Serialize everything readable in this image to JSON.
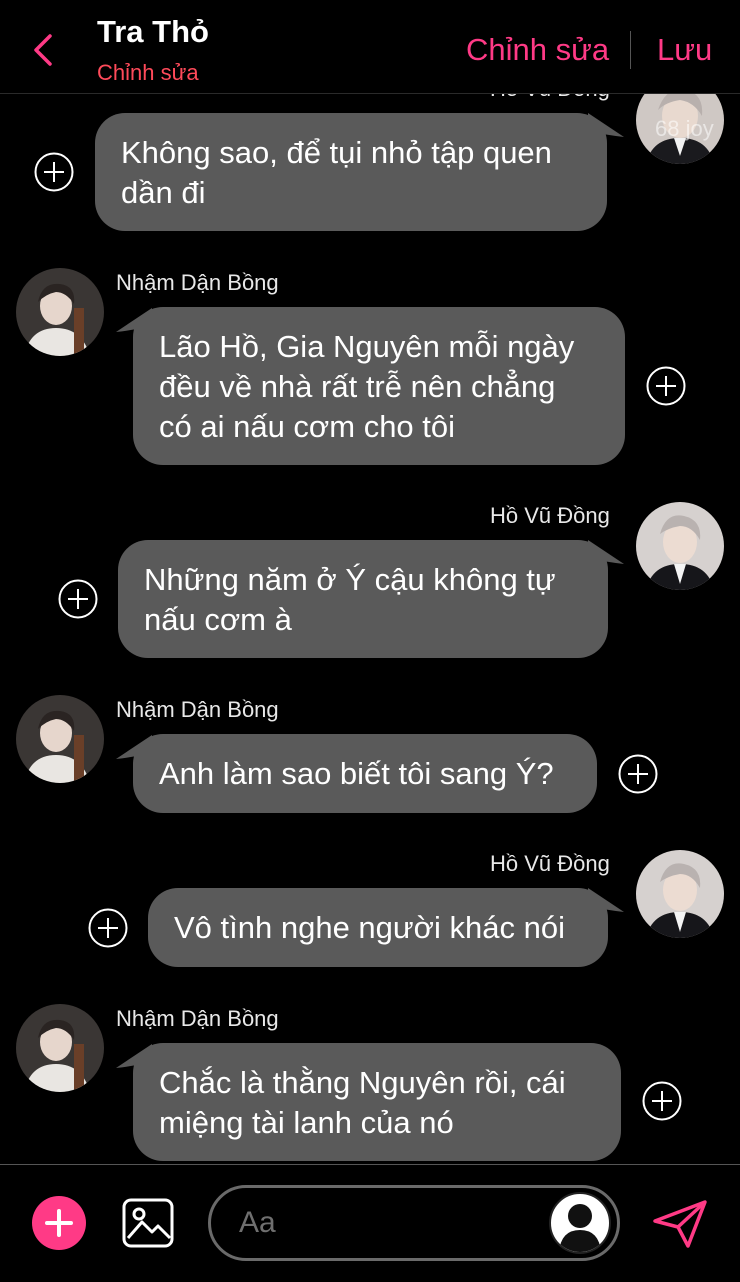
{
  "header": {
    "title": "Tra Thỏ",
    "subtitle": "Chỉnh sửa",
    "edit_label": "Chỉnh sửa",
    "save_label": "Lưu",
    "accent": "#ff3a86"
  },
  "messages": [
    {
      "sender": "Hồ Vũ Đồng",
      "side": "right",
      "text_lines": [
        "Không sao, để tụi nhỏ tập quen",
        "dần đi"
      ]
    },
    {
      "sender": "Nhậm Dận Bồng",
      "side": "left",
      "text_lines": [
        "Lão Hồ, Gia Nguyên mỗi ngày",
        "đều về nhà rất trễ nên chẳng",
        "có ai nấu cơm cho tôi"
      ]
    },
    {
      "sender": "Hồ Vũ Đồng",
      "side": "right",
      "text_lines": [
        "Những năm ở Ý cậu không tự",
        "nấu cơm à"
      ]
    },
    {
      "sender": "Nhậm Dận Bồng",
      "side": "left",
      "text_lines": [
        "Anh làm sao biết tôi sang Ý?"
      ]
    },
    {
      "sender": "Hồ Vũ Đồng",
      "side": "right",
      "text_lines": [
        "Vô tình nghe người khác nói"
      ]
    },
    {
      "sender": "Nhậm Dận Bồng",
      "side": "left",
      "text_lines": [
        "Chắc là thằng Nguyên rồi, cái",
        "miệng tài lanh của nó"
      ]
    }
  ],
  "watermark": "68 joy",
  "composer": {
    "placeholder": "Aa"
  },
  "icons": {
    "back": "chevron-left-icon",
    "add": "plus-icon",
    "image": "image-icon",
    "send": "send-icon",
    "reaction": "add-reaction-icon"
  }
}
